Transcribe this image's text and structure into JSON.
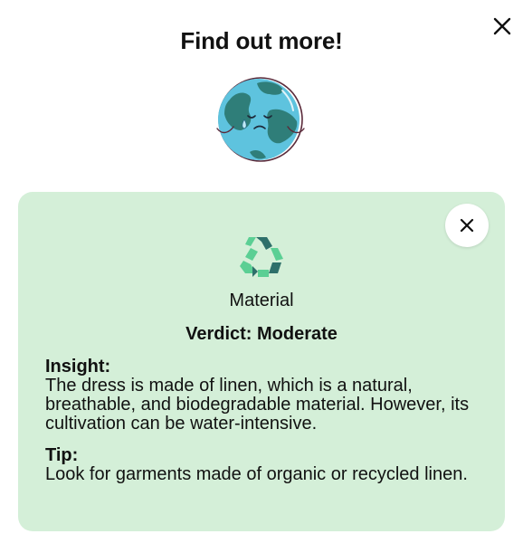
{
  "modal": {
    "title": "Find out more!",
    "close_icon": "close-icon",
    "illustration": "crying-earth-illustration"
  },
  "card": {
    "icon": "recycle-icon",
    "category": "Material",
    "verdict": "Verdict: Moderate",
    "insight_label": "Insight:",
    "insight_text": "The dress is made of linen, which is a natural, breathable, and biodegradable material. However, its cultivation can be water-intensive.",
    "tip_label": "Tip:",
    "tip_text": "Look for garments made of organic or recycled linen.",
    "close_icon": "close-icon"
  },
  "colors": {
    "card_background": "#d4efd8",
    "recycle_dark": "#2e6f6a",
    "recycle_light": "#5bcf94",
    "earth_ocean": "#5ec3de",
    "earth_land": "#2f7e79"
  }
}
